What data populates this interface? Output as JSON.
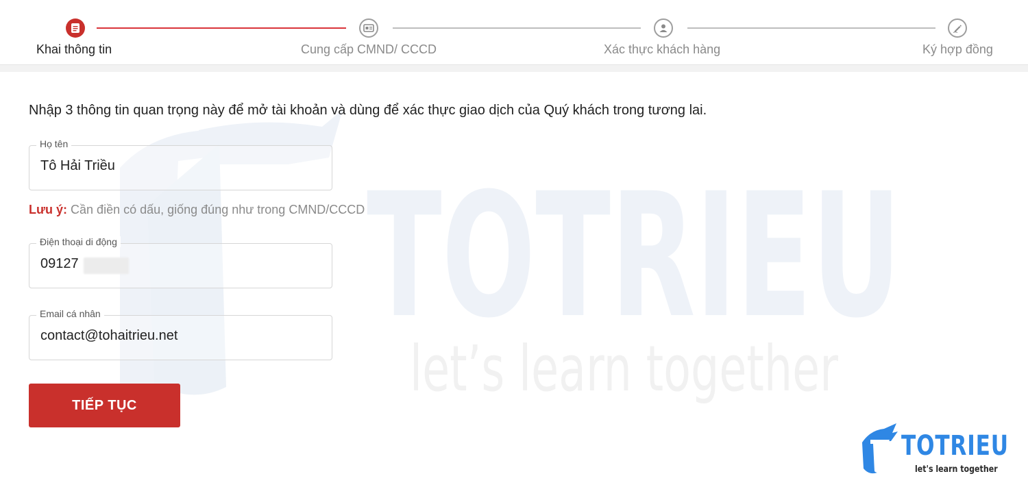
{
  "stepper": {
    "steps": [
      {
        "label": "Khai thông tin",
        "state": "active",
        "icon": "form-icon"
      },
      {
        "label": "Cung cấp CMND/ CCCD",
        "state": "inactive",
        "icon": "id-card-icon"
      },
      {
        "label": "Xác thực khách hàng",
        "state": "inactive",
        "icon": "user-icon"
      },
      {
        "label": "Ký hợp đồng",
        "state": "inactive",
        "icon": "pen-sign-icon"
      }
    ]
  },
  "intro": "Nhập 3 thông tin quan trọng này để mở tài khoản và dùng để xác thực giao dịch của Quý khách trong tương lai.",
  "form": {
    "name": {
      "label": "Họ tên",
      "value": "Tô Hải Triều"
    },
    "note": {
      "strong": "Lưu ý:",
      "text": " Cần điền có dấu, giống đúng như trong CMND/CCCD"
    },
    "phone": {
      "label": "Điện thoại di động",
      "value": "09127"
    },
    "email": {
      "label": "Email cá nhân",
      "value": "contact@tohaitrieu.net"
    },
    "submit_label": "TIẾP TỤC"
  },
  "watermark": {
    "title": "TOTRIEU",
    "tagline": "let’s learn together"
  },
  "logo": {
    "title": "TOTRIEU",
    "tagline": "let's learn together"
  },
  "colors": {
    "accent": "#c9302c",
    "brand_blue": "#2f87e4",
    "inactive": "#9e9e9e"
  }
}
